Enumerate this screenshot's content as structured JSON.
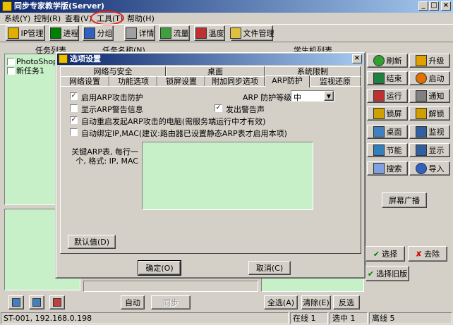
{
  "window": {
    "title": "同步专家教学版(Server)"
  },
  "menu": [
    {
      "label": "系统(Y)"
    },
    {
      "label": "控制(R)"
    },
    {
      "label": "查看(V)"
    },
    {
      "label": "工具(T)"
    },
    {
      "label": "帮助(H)"
    }
  ],
  "toolbar": [
    {
      "label": "IP管理",
      "icon": "ip-manage-icon",
      "color": "#e0b000"
    },
    {
      "label": "进程",
      "icon": "process-icon",
      "color": "#008000"
    },
    {
      "label": "分组",
      "icon": "group-icon",
      "color": "#3060c0"
    },
    {
      "label": "详情",
      "icon": "detail-icon",
      "color": "#808080"
    },
    {
      "label": "流量",
      "icon": "traffic-icon",
      "color": "#40a040"
    },
    {
      "label": "温度",
      "icon": "temperature-icon",
      "color": "#c03030"
    },
    {
      "label": "文件管理",
      "icon": "file-manage-icon",
      "color": "#e0c040"
    }
  ],
  "left_panel": {
    "header_task_list": "任务列表",
    "header_task_name": "任务名称(N)",
    "tasks": [
      "PhotoShop",
      "新任务1"
    ],
    "bottom_buttons": [
      "自动",
      "同步"
    ]
  },
  "right_panel": {
    "header_student_list": "学生机列表",
    "commands": [
      {
        "label": "刷新",
        "icon": "refresh-icon"
      },
      {
        "label": "升级",
        "icon": "upgrade-icon"
      },
      {
        "label": "结束",
        "icon": "end-icon"
      },
      {
        "label": "启动",
        "icon": "start-icon"
      },
      {
        "label": "运行",
        "icon": "run-icon"
      },
      {
        "label": "通知",
        "icon": "notify-icon"
      },
      {
        "label": "锁屏",
        "icon": "lock-screen-icon"
      },
      {
        "label": "解锁",
        "icon": "unlock-icon"
      },
      {
        "label": "桌面",
        "icon": "desktop-icon"
      },
      {
        "label": "监视",
        "icon": "monitor-icon"
      },
      {
        "label": "节能",
        "icon": "power-save-icon"
      },
      {
        "label": "显示",
        "icon": "display-icon"
      },
      {
        "label": "搜索",
        "icon": "search-icon"
      },
      {
        "label": "导入",
        "icon": "import-icon"
      }
    ],
    "broadcast_label": "屏幕广播",
    "select_label": "选择",
    "remove_label": "去除",
    "select_old_label": "选择旧版",
    "select_all_label": "全选(A)",
    "clear_label": "清除(E)",
    "invert_label": "反选"
  },
  "status_bar": {
    "host": "ST-001, 192.168.0.198",
    "online": "在线 1",
    "selected": "选中 1",
    "offline": "离线 5"
  },
  "dialog": {
    "title": "选项设置",
    "tabs_row1": [
      "网络与安全",
      "桌面",
      "系统限制"
    ],
    "tabs_row2": [
      "网络设置",
      "功能选项",
      "锁屏设置",
      "附加同步选项",
      "ARP防护",
      "监视还原"
    ],
    "active_tab": "ARP防护",
    "enable_arp_label": "启用ARP攻击防护",
    "protect_level_label": "ARP 防护等级:",
    "protect_level_value": "中",
    "show_warning_label": "显示ARP警告信息",
    "send_alarm_label": "发出警告声",
    "auto_restart_label": "自动重启发起ARP攻击的电脑(需服务端运行中才有效)",
    "auto_bind_label": "自动绑定IP,MAC(建议:路由器已设置静态ARP表才启用本项)",
    "arp_table_label": "关键ARP表, 每行一个, 格式: IP, MAC",
    "arp_table_value": "",
    "default_button": "默认值(D)",
    "ok_button": "确定(O)",
    "cancel_button": "取消(C)",
    "checks": {
      "enable_arp": true,
      "show_warning": false,
      "send_alarm": true,
      "auto_restart": true,
      "auto_bind": false
    }
  },
  "colors": {
    "title_start": "#0a246a",
    "title_end": "#a6caf0",
    "face": "#d4d0c8",
    "list_green": "#c8f0c8",
    "highlight_circle": "#e02020"
  }
}
